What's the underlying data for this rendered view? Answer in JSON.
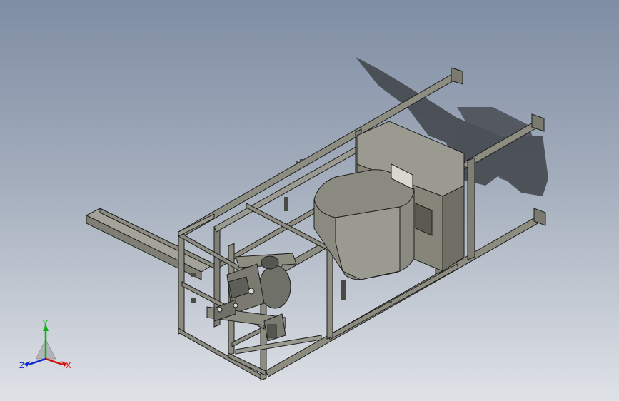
{
  "triad": {
    "x_label": "X",
    "y_label": "Y",
    "z_label": "Z",
    "x_color": "#d01010",
    "y_color": "#10b010",
    "z_color": "#1028d0"
  },
  "colors": {
    "frame": "#8c8c80",
    "frame_edge": "#1e1e1e",
    "hopper": "#8a8a80",
    "motor": "#6f7068",
    "shadow": "#3f4348"
  }
}
